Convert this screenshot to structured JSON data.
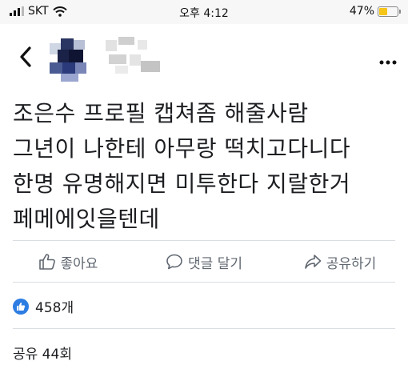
{
  "status_bar": {
    "carrier": "SKT",
    "time": "오후 4:12",
    "battery_percent": "47%",
    "battery_level": 0.47,
    "battery_color": "#f5c518"
  },
  "header": {
    "back_icon": "chevron-left-icon",
    "more_icon": "more-horizontal-icon",
    "author_avatar": "blurred",
    "author_name": "blurred"
  },
  "post": {
    "lines": [
      "조은수 프로필 캡쳐좀 해줄사람",
      "그년이 나한테 아무랑 떡치고다니다",
      "한명 유명해지면 미투한다 지랄한거",
      "페메에잇을텐데"
    ]
  },
  "actions": {
    "like_label": "좋아요",
    "comment_label": "댓글 달기",
    "share_label": "공유하기"
  },
  "reactions": {
    "count": "458개",
    "accent_color": "#2d7de2"
  },
  "shares": {
    "text": "공유 44회"
  }
}
